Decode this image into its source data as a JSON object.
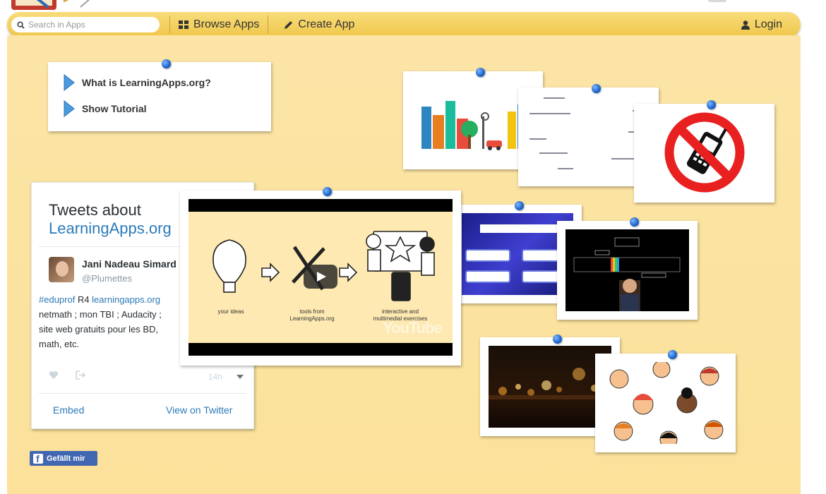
{
  "navbar": {
    "search_placeholder": "Search in Apps",
    "browse_label": "Browse Apps",
    "create_label": "Create App",
    "login_label": "Login"
  },
  "intro": {
    "what_is": "What is LearningApps.org?",
    "tutorial": "Show Tutorial"
  },
  "tweets": {
    "title_line1": "Tweets about",
    "title_line2": "LearningApps.org",
    "author_name": "Jani Nadeau Simard",
    "author_handle": "@Plumettes",
    "text_hashtag": "#eduprof",
    "text_r4": " R4 ",
    "text_link": "learningapps.org",
    "text_line2": "netmath ; mon TBI ; Audacity ;",
    "text_line3": "site web gratuits pour les BD,",
    "text_line4": "math, etc.",
    "date": "14h",
    "embed_label": "Embed",
    "view_label": "View on Twitter"
  },
  "video": {
    "label_ideas": "your ideas",
    "label_tools_1": "tools from",
    "label_tools_2": "LearningApps.org",
    "label_interactive_1": "interactive and",
    "label_interactive_2": "multimedial exercises",
    "youtube_mark": "YouTube"
  },
  "facebook": {
    "like_label": "Gefällt mir"
  },
  "colors": {
    "board": "#fbe19a",
    "navbar": "#efc649",
    "pin": "#1d63c9",
    "twitter_link": "#2b7bb9",
    "facebook": "#4267b2"
  }
}
